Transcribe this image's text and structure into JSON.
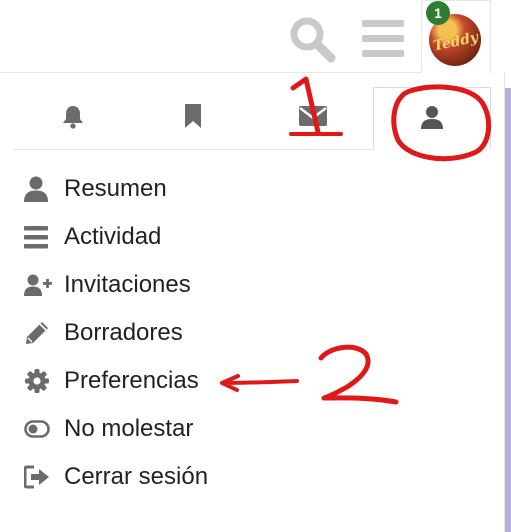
{
  "header": {
    "icons": [
      "search-icon",
      "hamburger-icon"
    ],
    "notification_count": "1",
    "avatar_scribble": "Teddy"
  },
  "tabs": [
    {
      "name": "notifications",
      "icon": "bell-icon"
    },
    {
      "name": "bookmarks",
      "icon": "bookmark-icon"
    },
    {
      "name": "messages",
      "icon": "envelope-icon"
    },
    {
      "name": "profile",
      "icon": "user-icon",
      "active": true
    }
  ],
  "menu": {
    "items": [
      {
        "label": "Resumen",
        "icon": "user-icon"
      },
      {
        "label": "Actividad",
        "icon": "list-icon"
      },
      {
        "label": "Invitaciones",
        "icon": "user-plus-icon"
      },
      {
        "label": "Borradores",
        "icon": "pencil-icon"
      },
      {
        "label": "Preferencias",
        "icon": "gear-icon"
      },
      {
        "label": "No molestar",
        "icon": "toggle-icon"
      },
      {
        "label": "Cerrar sesión",
        "icon": "sign-out-icon"
      }
    ]
  },
  "annotations": {
    "color": "#e01818",
    "marks": [
      "1",
      "2"
    ]
  },
  "colors": {
    "icon_gray": "#6b6b6b",
    "header_icon_gray": "#c9c9c9",
    "badge_green": "#2e7d32",
    "side_strip": "#b9addc"
  }
}
